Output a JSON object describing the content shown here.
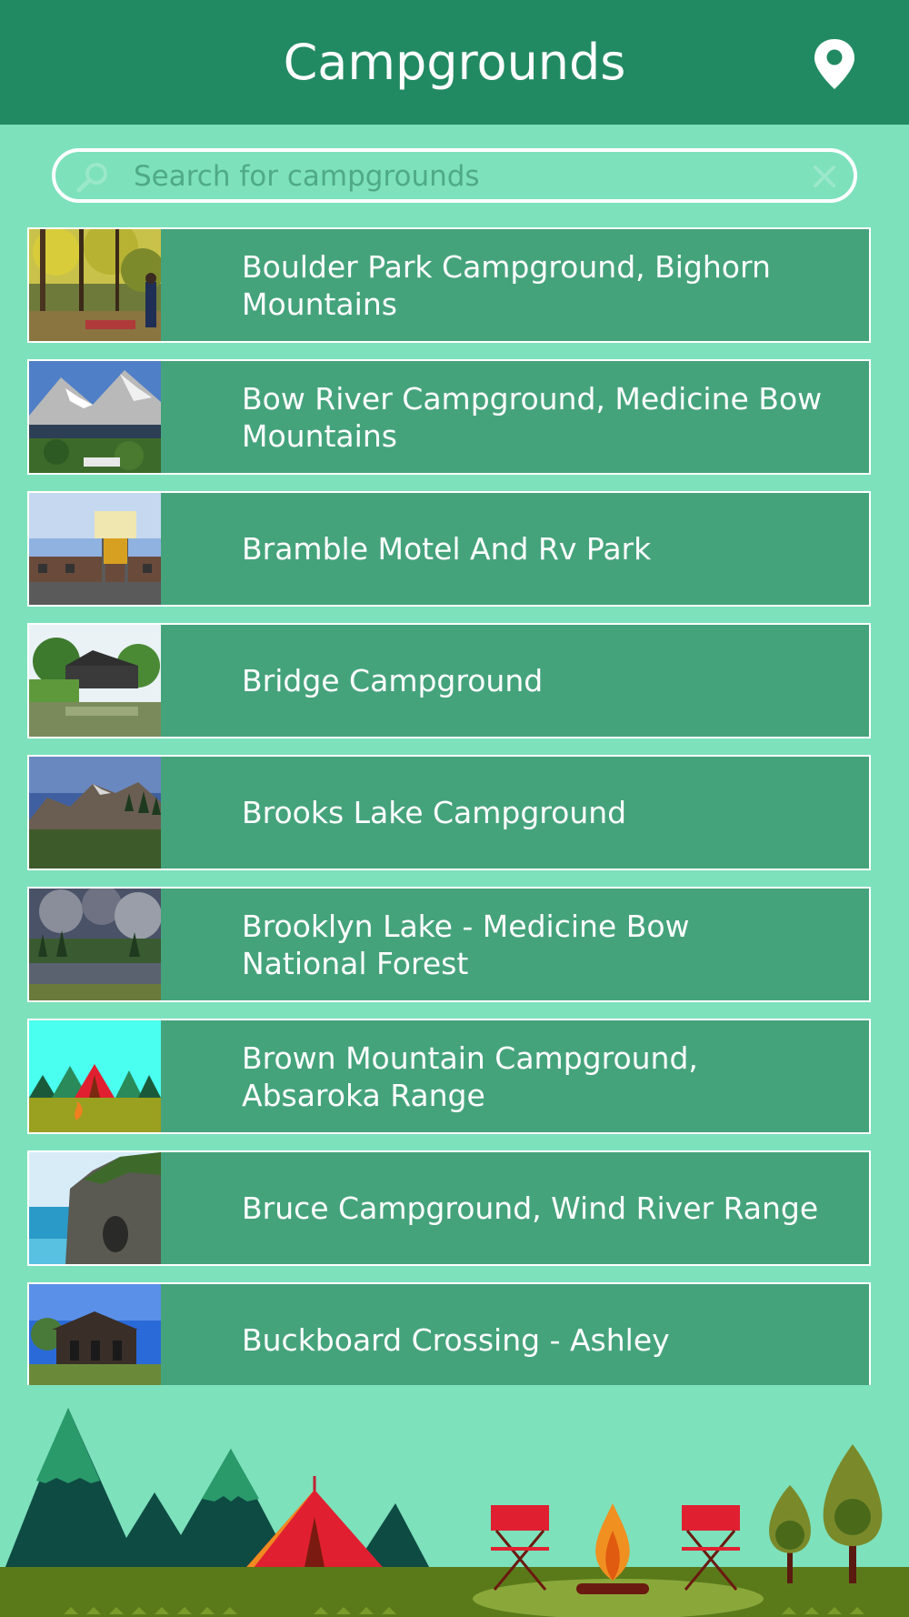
{
  "header": {
    "title": "Campgrounds",
    "map_icon": "map-pin-icon",
    "background_color": "#228a62"
  },
  "search": {
    "placeholder": "Search for campgrounds",
    "value": "",
    "search_icon": "search-icon",
    "clear_icon": "close-icon"
  },
  "campgrounds": [
    {
      "name": "Boulder Park Campground, Bighorn Mountains",
      "thumbnail": "forest-campsite-photo"
    },
    {
      "name": "Bow River Campground, Medicine Bow Mountains",
      "thumbnail": "mountain-lake-photo"
    },
    {
      "name": "Bramble Motel And Rv Park",
      "thumbnail": "motel-sign-photo"
    },
    {
      "name": "Bridge Campground",
      "thumbnail": "covered-bridge-photo"
    },
    {
      "name": "Brooks Lake Campground",
      "thumbnail": "mountain-ridge-photo"
    },
    {
      "name": "Brooklyn Lake - Medicine Bow National Forest",
      "thumbnail": "cloudy-lake-photo"
    },
    {
      "name": "Brown Mountain Campground, Absaroka Range",
      "thumbnail": "tent-illustration"
    },
    {
      "name": "Bruce Campground, Wind River Range",
      "thumbnail": "sea-cliff-photo"
    },
    {
      "name": "Buckboard Crossing - Ashley",
      "thumbnail": "cabin-building-photo"
    }
  ],
  "colors": {
    "background": "#7de1bc",
    "list_item": "#45a37c",
    "list_item_border": "#ffffff"
  },
  "footer": {
    "illustration": "campsite-illustration"
  }
}
